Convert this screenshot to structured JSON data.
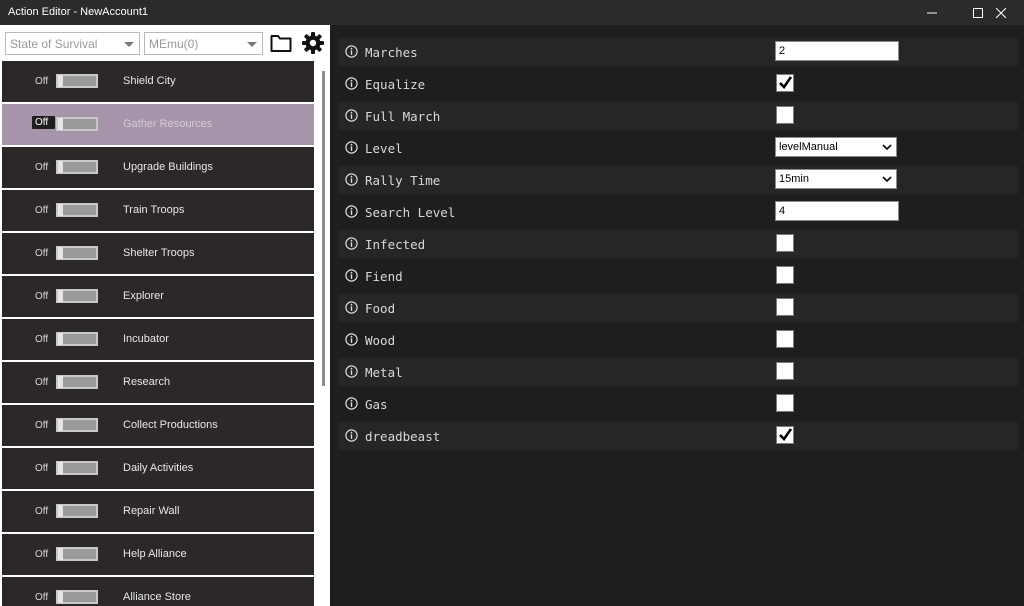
{
  "window": {
    "title": "Action Editor - NewAccount1"
  },
  "toolbar": {
    "game_select": "State of Survival",
    "emulator_select": "MEmu(0)"
  },
  "actions": [
    {
      "state": "Off",
      "label": "Shield City"
    },
    {
      "state": "Off",
      "label": "Gather Resources",
      "selected": true
    },
    {
      "state": "Off",
      "label": "Upgrade Buildings"
    },
    {
      "state": "Off",
      "label": "Train Troops"
    },
    {
      "state": "Off",
      "label": "Shelter Troops"
    },
    {
      "state": "Off",
      "label": "Explorer"
    },
    {
      "state": "Off",
      "label": "Incubator"
    },
    {
      "state": "Off",
      "label": "Research"
    },
    {
      "state": "Off",
      "label": "Collect Productions"
    },
    {
      "state": "Off",
      "label": "Daily Activities"
    },
    {
      "state": "Off",
      "label": "Repair Wall"
    },
    {
      "state": "Off",
      "label": "Help Alliance"
    },
    {
      "state": "Off",
      "label": "Alliance Store"
    }
  ],
  "properties": {
    "marches": {
      "label": "Marches",
      "value": "2"
    },
    "equalize": {
      "label": "Equalize",
      "checked": true
    },
    "full_march": {
      "label": "Full March",
      "checked": false
    },
    "level": {
      "label": "Level",
      "value": "levelManual"
    },
    "rally_time": {
      "label": "Rally Time",
      "value": "15min"
    },
    "search_level": {
      "label": "Search Level",
      "value": "4"
    },
    "infected": {
      "label": "Infected",
      "checked": false
    },
    "fiend": {
      "label": "Fiend",
      "checked": false
    },
    "food": {
      "label": "Food",
      "checked": false
    },
    "wood": {
      "label": "Wood",
      "checked": false
    },
    "metal": {
      "label": "Metal",
      "checked": false
    },
    "gas": {
      "label": "Gas",
      "checked": false
    },
    "dreadbeast": {
      "label": "dreadbeast",
      "checked": true
    }
  },
  "colors": {
    "selected_action": "#a694aa",
    "action_bg": "#2b2827",
    "panel_bg": "#1e1e1e"
  }
}
